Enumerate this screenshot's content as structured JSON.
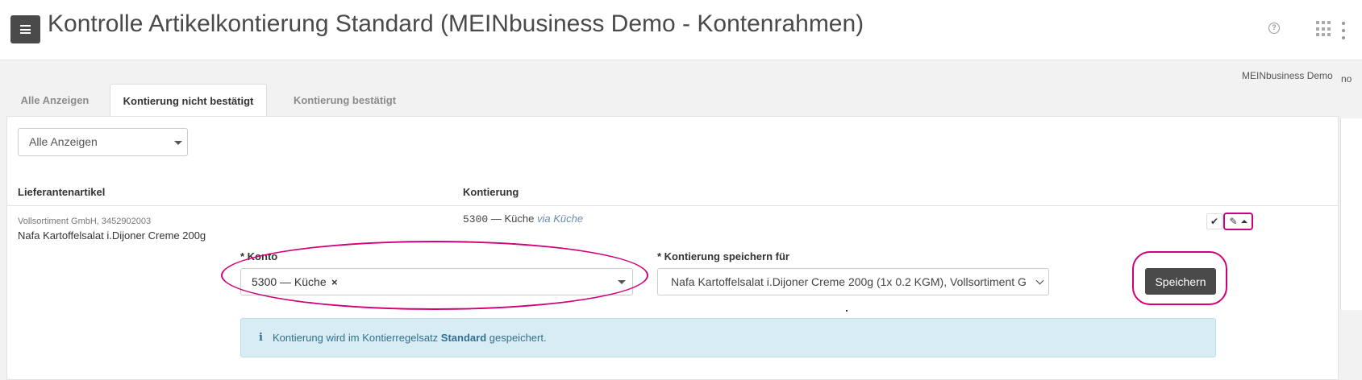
{
  "header": {
    "title": "Kontrolle Artikelkontierung Standard (MEINbusiness Demo - Kontenrahmen)",
    "help_icon": "help-circle-icon",
    "apps_icon": "apps-grid-icon",
    "more_icon": "more-vertical-icon",
    "menu_icon": "menu-icon"
  },
  "company": {
    "name": "MEINbusiness Demo",
    "cut_text": "no"
  },
  "tabs": [
    {
      "label": "Alle Anzeigen",
      "active": false
    },
    {
      "label": "Kontierung nicht bestätigt",
      "active": true
    },
    {
      "label": "Kontierung bestätigt",
      "active": false
    }
  ],
  "filter": {
    "selected": "Alle Anzeigen"
  },
  "table": {
    "columns": [
      "Lieferantenartikel",
      "Kontierung"
    ],
    "row": {
      "supplier": "Vollsortiment GmbH, 3452902003",
      "article": "Nafa Kartoffelsalat i.Dijoner Creme 200g",
      "konto_number": "5300",
      "konto_name": "— Küche",
      "via_prefix": "via",
      "via_name": "Küche"
    }
  },
  "form": {
    "konto_label": "* Konto",
    "konto_value": "5300 — Küche",
    "konto_clear": "×",
    "save_for_label": "* Kontierung speichern für",
    "save_for_value": "Nafa Kartoffelsalat i.Dijoner Creme 200g (1x 0.2 KGM), Vollsortiment G",
    "save_button": "Speichern"
  },
  "info": {
    "icon": "info-icon",
    "text_before": "Kontierung wird im Kontierregelsatz",
    "text_bold": "Standard",
    "text_after": "gespeichert."
  },
  "colors": {
    "highlight": "#d0007a",
    "dark_button": "#4a4a4a",
    "info_bg": "#d8ecf4",
    "info_text": "#31708f"
  }
}
